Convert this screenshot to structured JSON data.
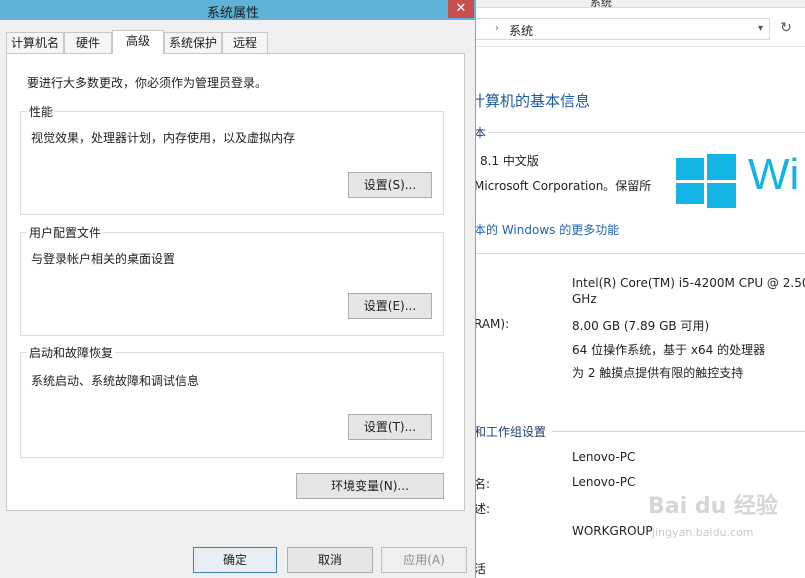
{
  "background_window": {
    "title": "系统",
    "address": {
      "crumb": "系统",
      "separator": "›"
    },
    "heading": "计算机的基本信息",
    "section_edition": "本",
    "edition": "8.1 中文版",
    "copyright": "Microsoft Corporation。保留所",
    "logo_text": "Wi",
    "more_features_link": "本的 Windows 的更多功能",
    "cpu": "Intel(R) Core(TM) i5-4200M CPU @ 2.50",
    "cpu_cont": "GHz",
    "ram_label": "RAM):",
    "ram": "8.00 GB (7.89 GB 可用)",
    "system_type": "64 位操作系统，基于 x64 的处理器",
    "touch": "为 2 触摸点提供有限的触控支持",
    "workgroup_section": "和工作组设置",
    "computer_name": "Lenovo-PC",
    "full_name_label": "名:",
    "full_name": "Lenovo-PC",
    "desc_label": "述:",
    "workgroup": "WORKGROUP",
    "bottom_cut": "活"
  },
  "dialog": {
    "title": "系统属性",
    "close_glyph": "✕",
    "tabs": [
      "计算机名",
      "硬件",
      "高级",
      "系统保护",
      "远程"
    ],
    "active_tab": "高级",
    "note": "要进行大多数更改，你必须作为管理员登录。",
    "groups": {
      "performance": {
        "label": "性能",
        "desc": "视觉效果，处理器计划，内存使用，以及虚拟内存",
        "button": "设置(S)..."
      },
      "user_profiles": {
        "label": "用户配置文件",
        "desc": "与登录帐户相关的桌面设置",
        "button": "设置(E)..."
      },
      "startup_recovery": {
        "label": "启动和故障恢复",
        "desc": "系统启动、系统故障和调试信息",
        "button": "设置(T)..."
      }
    },
    "env_button": "环境变量(N)...",
    "ok": "确定",
    "cancel": "取消",
    "apply": "应用(A)"
  },
  "watermark": {
    "text": "Bai du 经验",
    "sub": "jingyan.baidu.com"
  },
  "colors": {
    "titlebar": "#5fb3d6",
    "close": "#c74f4f",
    "link": "#1e64b4",
    "win_blue": "#14b4e6"
  }
}
